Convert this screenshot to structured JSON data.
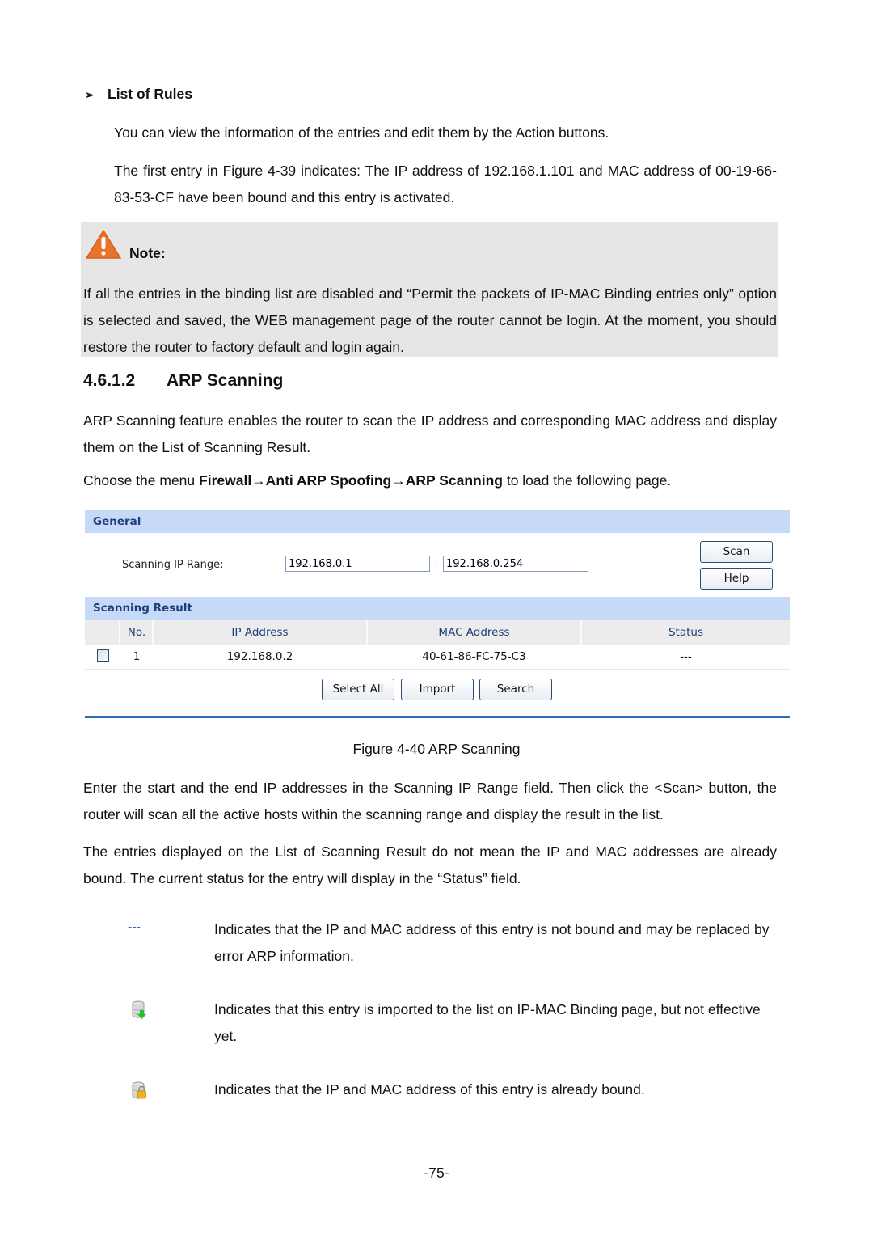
{
  "list_of_rules": {
    "heading": "List of Rules",
    "para1": "You can view the information of the entries and edit them by the Action buttons.",
    "para2": "The first entry in Figure 4-39 indicates: The IP address of 192.168.1.101 and MAC address of 00-19-66-83-53-CF have been bound and this entry is activated."
  },
  "note": {
    "title": "Note:",
    "icon": "warning-triangle-icon",
    "text": "If all the entries in the binding list are disabled and “Permit the packets of IP-MAC Binding entries only” option is selected and saved, the WEB management page of the router cannot be login. At the moment, you should restore the router to factory default and login again."
  },
  "section": {
    "number": "4.6.1.2",
    "title": "ARP Scanning",
    "intro": "ARP Scanning feature enables the router to scan the IP address and corresponding MAC address and display them on the List of Scanning Result.",
    "menu_prefix": "Choose the menu ",
    "menu_path": "Firewall→Anti ARP Spoofing→ARP Scanning",
    "menu_suffix": " to load the following page."
  },
  "figure": {
    "general_title": "General",
    "range_label": "Scanning IP Range:",
    "start_ip": "192.168.0.1",
    "range_separator": "-",
    "end_ip": "192.168.0.254",
    "scan_button": "Scan",
    "help_button": "Help",
    "result_title": "Scanning Result",
    "columns": [
      "No.",
      "IP Address",
      "MAC Address",
      "Status"
    ],
    "rows": [
      {
        "checked": false,
        "no": "1",
        "ip": "192.168.0.2",
        "mac": "40-61-86-FC-75-C3",
        "status": "---"
      }
    ],
    "select_all_button": "Select All",
    "import_button": "Import",
    "search_button": "Search",
    "caption": "Figure 4-40 ARP Scanning"
  },
  "body": {
    "para1": "Enter the start and the end IP addresses in the Scanning IP Range field. Then click the <Scan> button, the router will scan all the active hosts within the scanning range and display the result in the list.",
    "para2": "The entries displayed on the List of Scanning Result do not mean the IP and MAC addresses are already bound. The current status for the entry will display in the “Status” field."
  },
  "legend": [
    {
      "symbol": "---",
      "icon": "not-bound-dashes",
      "text": "Indicates that the IP and MAC address of this entry is not bound and may be replaced by error ARP information."
    },
    {
      "symbol": "",
      "icon": "imported-database-icon",
      "text": "Indicates that this entry is imported to the list on IP-MAC Binding page, but not effective yet."
    },
    {
      "symbol": "",
      "icon": "bound-lock-database-icon",
      "text": "Indicates that the IP and MAC address of this entry is already bound."
    }
  ],
  "page_number": "-75-"
}
